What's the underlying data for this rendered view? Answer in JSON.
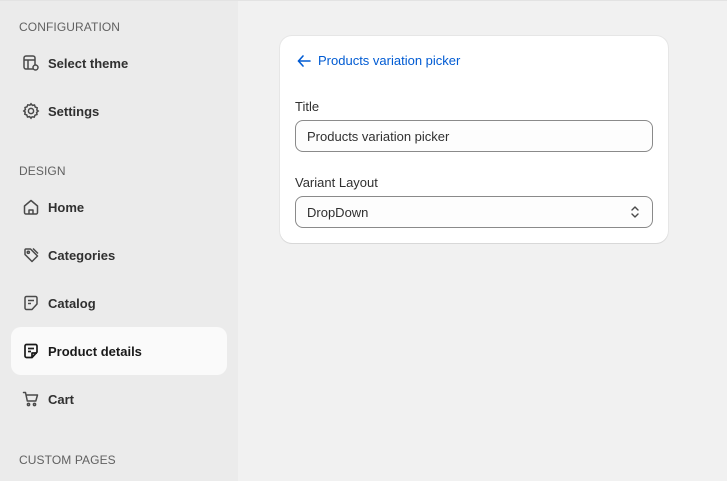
{
  "sidebar": {
    "sections": {
      "configuration": "CONFIGURATION",
      "design": "DESIGN",
      "custom_pages": "CUSTOM PAGES"
    },
    "items": [
      {
        "label": "Select theme",
        "icon": "theme-icon"
      },
      {
        "label": "Settings",
        "icon": "gear-icon"
      },
      {
        "label": "Home",
        "icon": "home-icon"
      },
      {
        "label": "Categories",
        "icon": "tag-icon"
      },
      {
        "label": "Catalog",
        "icon": "catalog-icon"
      },
      {
        "label": "Product details",
        "icon": "product-details-icon",
        "active": true
      },
      {
        "label": "Cart",
        "icon": "cart-icon"
      }
    ]
  },
  "card": {
    "back_label": "Products variation picker",
    "title_label": "Title",
    "title_value": "Products variation picker",
    "variant_label": "Variant Layout",
    "variant_value": "DropDown"
  },
  "colors": {
    "link": "#005bd3",
    "sidebar_bg": "#ebebeb",
    "page_bg": "#f1f1f1",
    "active_item_bg": "#fafafa"
  }
}
